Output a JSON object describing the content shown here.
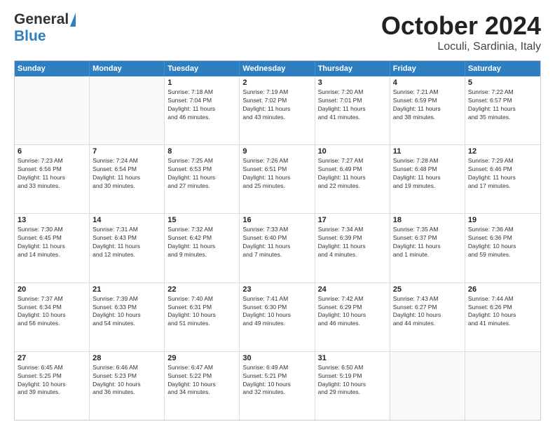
{
  "header": {
    "logo_general": "General",
    "logo_blue": "Blue",
    "title": "October 2024",
    "subtitle": "Loculi, Sardinia, Italy"
  },
  "weekdays": [
    "Sunday",
    "Monday",
    "Tuesday",
    "Wednesday",
    "Thursday",
    "Friday",
    "Saturday"
  ],
  "weeks": [
    [
      {
        "day": "",
        "lines": []
      },
      {
        "day": "",
        "lines": []
      },
      {
        "day": "1",
        "lines": [
          "Sunrise: 7:18 AM",
          "Sunset: 7:04 PM",
          "Daylight: 11 hours",
          "and 46 minutes."
        ]
      },
      {
        "day": "2",
        "lines": [
          "Sunrise: 7:19 AM",
          "Sunset: 7:02 PM",
          "Daylight: 11 hours",
          "and 43 minutes."
        ]
      },
      {
        "day": "3",
        "lines": [
          "Sunrise: 7:20 AM",
          "Sunset: 7:01 PM",
          "Daylight: 11 hours",
          "and 41 minutes."
        ]
      },
      {
        "day": "4",
        "lines": [
          "Sunrise: 7:21 AM",
          "Sunset: 6:59 PM",
          "Daylight: 11 hours",
          "and 38 minutes."
        ]
      },
      {
        "day": "5",
        "lines": [
          "Sunrise: 7:22 AM",
          "Sunset: 6:57 PM",
          "Daylight: 11 hours",
          "and 35 minutes."
        ]
      }
    ],
    [
      {
        "day": "6",
        "lines": [
          "Sunrise: 7:23 AM",
          "Sunset: 6:56 PM",
          "Daylight: 11 hours",
          "and 33 minutes."
        ]
      },
      {
        "day": "7",
        "lines": [
          "Sunrise: 7:24 AM",
          "Sunset: 6:54 PM",
          "Daylight: 11 hours",
          "and 30 minutes."
        ]
      },
      {
        "day": "8",
        "lines": [
          "Sunrise: 7:25 AM",
          "Sunset: 6:53 PM",
          "Daylight: 11 hours",
          "and 27 minutes."
        ]
      },
      {
        "day": "9",
        "lines": [
          "Sunrise: 7:26 AM",
          "Sunset: 6:51 PM",
          "Daylight: 11 hours",
          "and 25 minutes."
        ]
      },
      {
        "day": "10",
        "lines": [
          "Sunrise: 7:27 AM",
          "Sunset: 6:49 PM",
          "Daylight: 11 hours",
          "and 22 minutes."
        ]
      },
      {
        "day": "11",
        "lines": [
          "Sunrise: 7:28 AM",
          "Sunset: 6:48 PM",
          "Daylight: 11 hours",
          "and 19 minutes."
        ]
      },
      {
        "day": "12",
        "lines": [
          "Sunrise: 7:29 AM",
          "Sunset: 6:46 PM",
          "Daylight: 11 hours",
          "and 17 minutes."
        ]
      }
    ],
    [
      {
        "day": "13",
        "lines": [
          "Sunrise: 7:30 AM",
          "Sunset: 6:45 PM",
          "Daylight: 11 hours",
          "and 14 minutes."
        ]
      },
      {
        "day": "14",
        "lines": [
          "Sunrise: 7:31 AM",
          "Sunset: 6:43 PM",
          "Daylight: 11 hours",
          "and 12 minutes."
        ]
      },
      {
        "day": "15",
        "lines": [
          "Sunrise: 7:32 AM",
          "Sunset: 6:42 PM",
          "Daylight: 11 hours",
          "and 9 minutes."
        ]
      },
      {
        "day": "16",
        "lines": [
          "Sunrise: 7:33 AM",
          "Sunset: 6:40 PM",
          "Daylight: 11 hours",
          "and 7 minutes."
        ]
      },
      {
        "day": "17",
        "lines": [
          "Sunrise: 7:34 AM",
          "Sunset: 6:39 PM",
          "Daylight: 11 hours",
          "and 4 minutes."
        ]
      },
      {
        "day": "18",
        "lines": [
          "Sunrise: 7:35 AM",
          "Sunset: 6:37 PM",
          "Daylight: 11 hours",
          "and 1 minute."
        ]
      },
      {
        "day": "19",
        "lines": [
          "Sunrise: 7:36 AM",
          "Sunset: 6:36 PM",
          "Daylight: 10 hours",
          "and 59 minutes."
        ]
      }
    ],
    [
      {
        "day": "20",
        "lines": [
          "Sunrise: 7:37 AM",
          "Sunset: 6:34 PM",
          "Daylight: 10 hours",
          "and 56 minutes."
        ]
      },
      {
        "day": "21",
        "lines": [
          "Sunrise: 7:39 AM",
          "Sunset: 6:33 PM",
          "Daylight: 10 hours",
          "and 54 minutes."
        ]
      },
      {
        "day": "22",
        "lines": [
          "Sunrise: 7:40 AM",
          "Sunset: 6:31 PM",
          "Daylight: 10 hours",
          "and 51 minutes."
        ]
      },
      {
        "day": "23",
        "lines": [
          "Sunrise: 7:41 AM",
          "Sunset: 6:30 PM",
          "Daylight: 10 hours",
          "and 49 minutes."
        ]
      },
      {
        "day": "24",
        "lines": [
          "Sunrise: 7:42 AM",
          "Sunset: 6:29 PM",
          "Daylight: 10 hours",
          "and 46 minutes."
        ]
      },
      {
        "day": "25",
        "lines": [
          "Sunrise: 7:43 AM",
          "Sunset: 6:27 PM",
          "Daylight: 10 hours",
          "and 44 minutes."
        ]
      },
      {
        "day": "26",
        "lines": [
          "Sunrise: 7:44 AM",
          "Sunset: 6:26 PM",
          "Daylight: 10 hours",
          "and 41 minutes."
        ]
      }
    ],
    [
      {
        "day": "27",
        "lines": [
          "Sunrise: 6:45 AM",
          "Sunset: 5:25 PM",
          "Daylight: 10 hours",
          "and 39 minutes."
        ]
      },
      {
        "day": "28",
        "lines": [
          "Sunrise: 6:46 AM",
          "Sunset: 5:23 PM",
          "Daylight: 10 hours",
          "and 36 minutes."
        ]
      },
      {
        "day": "29",
        "lines": [
          "Sunrise: 6:47 AM",
          "Sunset: 5:22 PM",
          "Daylight: 10 hours",
          "and 34 minutes."
        ]
      },
      {
        "day": "30",
        "lines": [
          "Sunrise: 6:49 AM",
          "Sunset: 5:21 PM",
          "Daylight: 10 hours",
          "and 32 minutes."
        ]
      },
      {
        "day": "31",
        "lines": [
          "Sunrise: 6:50 AM",
          "Sunset: 5:19 PM",
          "Daylight: 10 hours",
          "and 29 minutes."
        ]
      },
      {
        "day": "",
        "lines": []
      },
      {
        "day": "",
        "lines": []
      }
    ]
  ]
}
